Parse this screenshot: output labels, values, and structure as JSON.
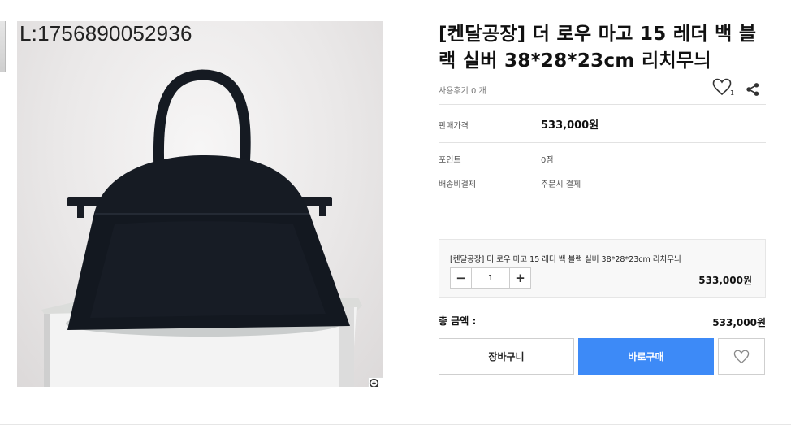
{
  "product": {
    "image_code": "L:1756890052936",
    "title": "[켄달공장] 더 로우 마고 15 레더 백 블랙 실버 38*28*23cm 리치무늬",
    "review_text": "사용후기 0 개",
    "wish_count": "1"
  },
  "info": {
    "price_label": "판매가격",
    "price_value": "533,000원",
    "point_label": "포인트",
    "point_value": "0점",
    "shipping_label": "배송비결제",
    "shipping_value": "주문시 결제"
  },
  "option": {
    "name": "[켄달공장] 더 로우 마고 15 레더 백 블랙 실버 38*28*23cm 리치무늬",
    "minus": "−",
    "quantity": "1",
    "plus": "+",
    "price": "533,000원"
  },
  "total": {
    "label": "총 금액 :",
    "value": "533,000원"
  },
  "buttons": {
    "cart": "장바구니",
    "buy": "바로구매"
  },
  "icons": {
    "wish": "heart-icon",
    "share": "share-icon",
    "zoom": "zoom-icon",
    "like": "heart-outline-icon"
  },
  "colors": {
    "buy_button": "#3d8af7",
    "bag": "#14181f"
  }
}
